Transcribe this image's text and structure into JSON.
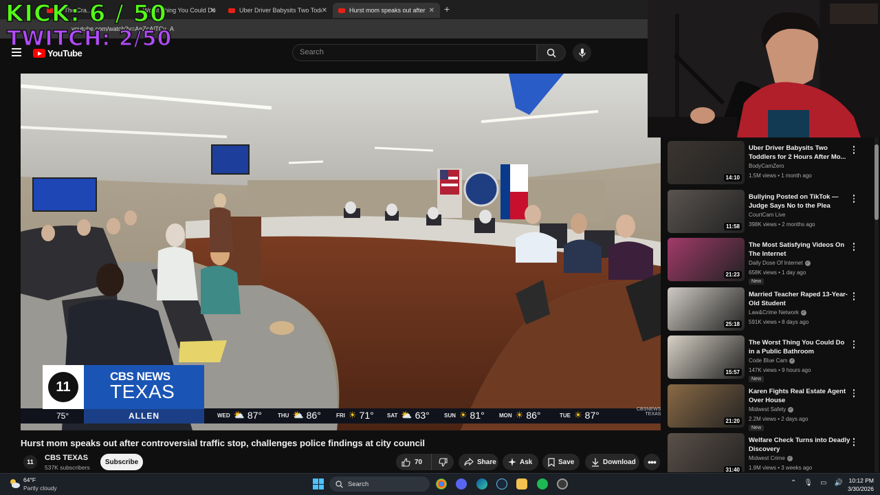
{
  "browser": {
    "tabs": [
      {
        "label": "in The Cra...",
        "active": false
      },
      {
        "label": "Worst Thing You Could Do",
        "active": false
      },
      {
        "label": "Uber Driver Babysits Two Toddlers",
        "active": false
      },
      {
        "label": "Hurst mom speaks out after co",
        "active": true
      }
    ],
    "url": "youtube.com/watch?v=AeZcAlTCv_A"
  },
  "overlay": {
    "kick": "KICK: 6 / 50",
    "twitch": "TWITCH: 2/50"
  },
  "youtube": {
    "logo": "YouTube",
    "search_placeholder": "Search"
  },
  "player": {
    "brand_l1": "CBS NEWS",
    "brand_l2": "TEXAS",
    "channel_number": "11",
    "current_temp": "75°",
    "city": "ALLEN",
    "network_tag_l1": "CBSNEWS",
    "network_tag_l2": "TEXAS",
    "forecast": [
      {
        "day": "WED",
        "icon": "cloud-sun",
        "temp": "87°"
      },
      {
        "day": "THU",
        "icon": "cloud-sun",
        "temp": "86°"
      },
      {
        "day": "FRI",
        "icon": "sun",
        "temp": "71°"
      },
      {
        "day": "SAT",
        "icon": "cloud-sun",
        "temp": "63°"
      },
      {
        "day": "SUN",
        "icon": "sun",
        "temp": "81°"
      },
      {
        "day": "MON",
        "icon": "sun",
        "temp": "86°"
      },
      {
        "day": "TUE",
        "icon": "sun",
        "temp": "87°"
      }
    ]
  },
  "video": {
    "title": "Hurst mom speaks out after controversial traffic stop, challenges police findings at city council",
    "channel": "CBS TEXAS",
    "subscribers": "537K subscribers",
    "subscribe_label": "Subscribe",
    "likes": "70",
    "share_label": "Share",
    "ask_label": "Ask",
    "save_label": "Save",
    "download_label": "Download"
  },
  "recommendations": [
    {
      "title": "Uber Driver Babysits Two Toddlers for 2 Hours After Mo...",
      "channel": "BodyCamZero",
      "verified": false,
      "meta": "1.5M views • 1 month ago",
      "duration": "14:10",
      "new": false,
      "thumb": "#3b3530"
    },
    {
      "title": "Bullying Posted on TikTok — Judge Says No to the Plea",
      "channel": "CourtCam Live",
      "verified": false,
      "meta": "398K views • 2 months ago",
      "duration": "11:58",
      "new": false,
      "thumb": "#5a5450"
    },
    {
      "title": "The Most Satisfying Videos On The Internet",
      "channel": "Daily Dose Of Internet",
      "verified": true,
      "meta": "658K views • 1 day ago",
      "duration": "21:23",
      "new": true,
      "thumb": "#a23a6a"
    },
    {
      "title": "Married Teacher Raped 13-Year-Old Student",
      "channel": "Law&Crime Network",
      "verified": true,
      "meta": "591K views • 8 days ago",
      "duration": "25:18",
      "new": false,
      "thumb": "#cfcac3"
    },
    {
      "title": "The Worst Thing You Could Do in a Public Bathroom",
      "channel": "Code Blue Cam",
      "verified": true,
      "meta": "147K views • 9 hours ago",
      "duration": "15:57",
      "new": true,
      "thumb": "#d8d2c6"
    },
    {
      "title": "Karen Fights Real Estate Agent Over House",
      "channel": "Midwest Safety",
      "verified": true,
      "meta": "2.2M views • 2 days ago",
      "duration": "21:20",
      "new": true,
      "thumb": "#8a6a45"
    },
    {
      "title": "Welfare Check Turns into Deadly Discovery",
      "channel": "Midwest Crime",
      "verified": true,
      "meta": "1.9M views • 3 weeks ago",
      "duration": "31:40",
      "new": false,
      "thumb": "#5b5048"
    }
  ],
  "taskbar": {
    "weather_temp": "64°F",
    "weather_desc": "Partly cloudy",
    "search_label": "Search",
    "time": "10:12 PM",
    "date": "3/30/2026"
  }
}
